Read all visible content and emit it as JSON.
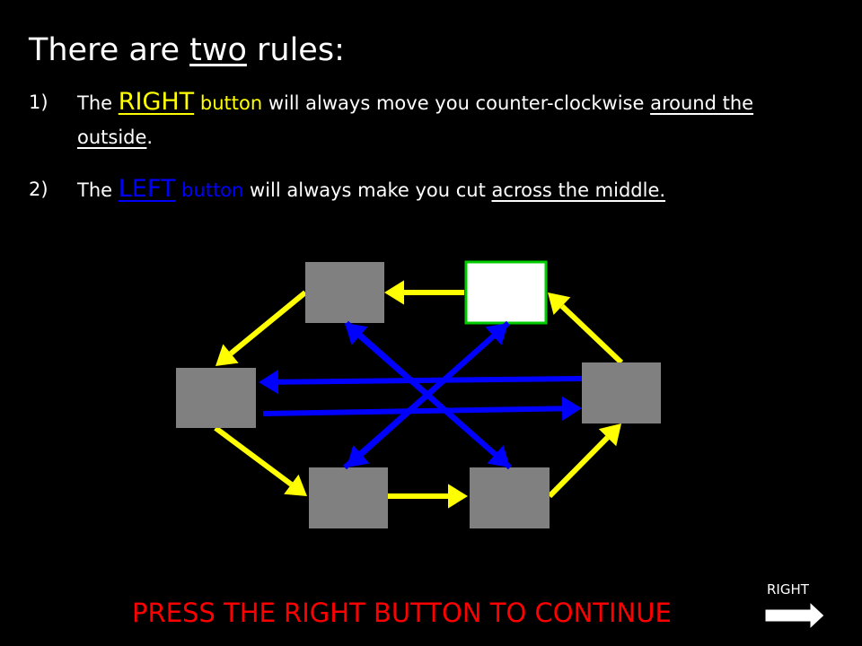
{
  "title": {
    "pre": "There are ",
    "underlined": "two",
    "post": " rules:"
  },
  "rules": [
    {
      "number": "1)",
      "pre": "The ",
      "keyword": "RIGHT",
      "keyword_suffix": " button",
      "mid": " will always move you counter-clockwise ",
      "underlined": "around the outside",
      "post": "."
    },
    {
      "number": "2)",
      "pre": "The ",
      "keyword": "LEFT",
      "keyword_suffix": " button",
      "mid": " will always make you cut ",
      "underlined": "across the middle.",
      "post": ""
    }
  ],
  "footer": {
    "prompt": "PRESS THE RIGHT BUTTON TO CONTINUE",
    "button_label": "RIGHT"
  },
  "colors": {
    "background": "#000000",
    "right_highlight": "#ffff00",
    "left_highlight": "#0000ff",
    "prompt": "#ff0000",
    "node_fill": "#808080",
    "current_node_fill": "#ffffff",
    "current_node_border": "#00cc00"
  },
  "diagram": {
    "nodes": [
      "top-left",
      "top-right",
      "right",
      "bottom-right",
      "bottom-left",
      "left"
    ],
    "current_node": "top-right",
    "right_button_moves": [
      [
        "top-right",
        "top-left"
      ],
      [
        "top-left",
        "left"
      ],
      [
        "left",
        "bottom-left"
      ],
      [
        "bottom-left",
        "bottom-right"
      ],
      [
        "bottom-right",
        "right"
      ],
      [
        "right",
        "top-right"
      ]
    ],
    "left_button_moves": [
      [
        "right",
        "left"
      ],
      [
        "left",
        "right"
      ],
      [
        "top-left",
        "bottom-right"
      ],
      [
        "bottom-right",
        "top-left"
      ],
      [
        "top-right",
        "bottom-left"
      ],
      [
        "bottom-left",
        "top-right"
      ]
    ]
  }
}
